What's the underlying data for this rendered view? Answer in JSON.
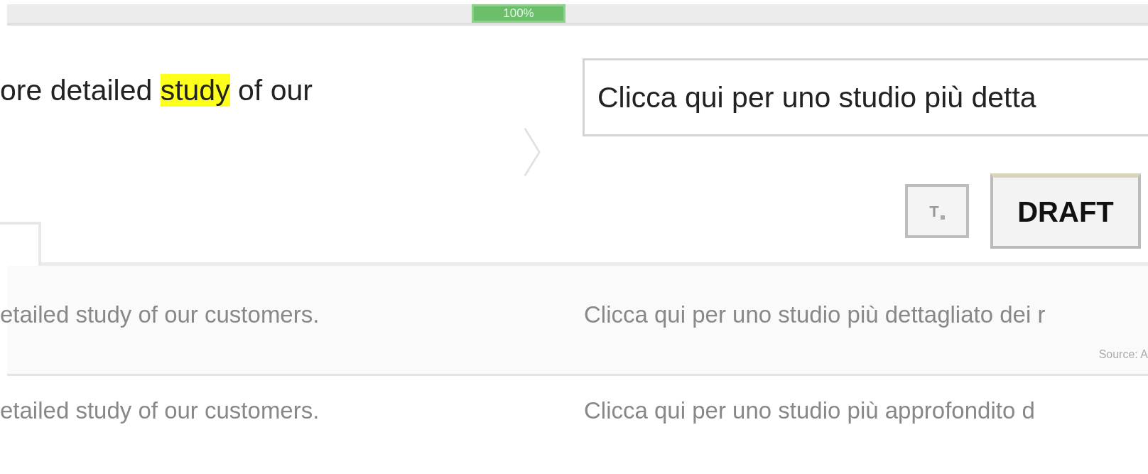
{
  "progress": {
    "label": "100%"
  },
  "segment": {
    "source_before": "ore detailed ",
    "source_highlight": "study",
    "source_after": " of our",
    "target_value": "Clicca qui per uno studio più detta"
  },
  "toolbar": {
    "buttons": [
      {
        "kind": "clear-format",
        "label": "T"
      },
      {
        "kind": "status",
        "label": "DRAFT"
      }
    ]
  },
  "rows": [
    {
      "source": "etailed study of our customers.",
      "target": "Clicca qui per uno studio più dettagliato dei r",
      "note": "Source: A"
    },
    {
      "source": "etailed study of our customers.",
      "target": "Clicca qui per uno studio più approfondito d"
    }
  ]
}
